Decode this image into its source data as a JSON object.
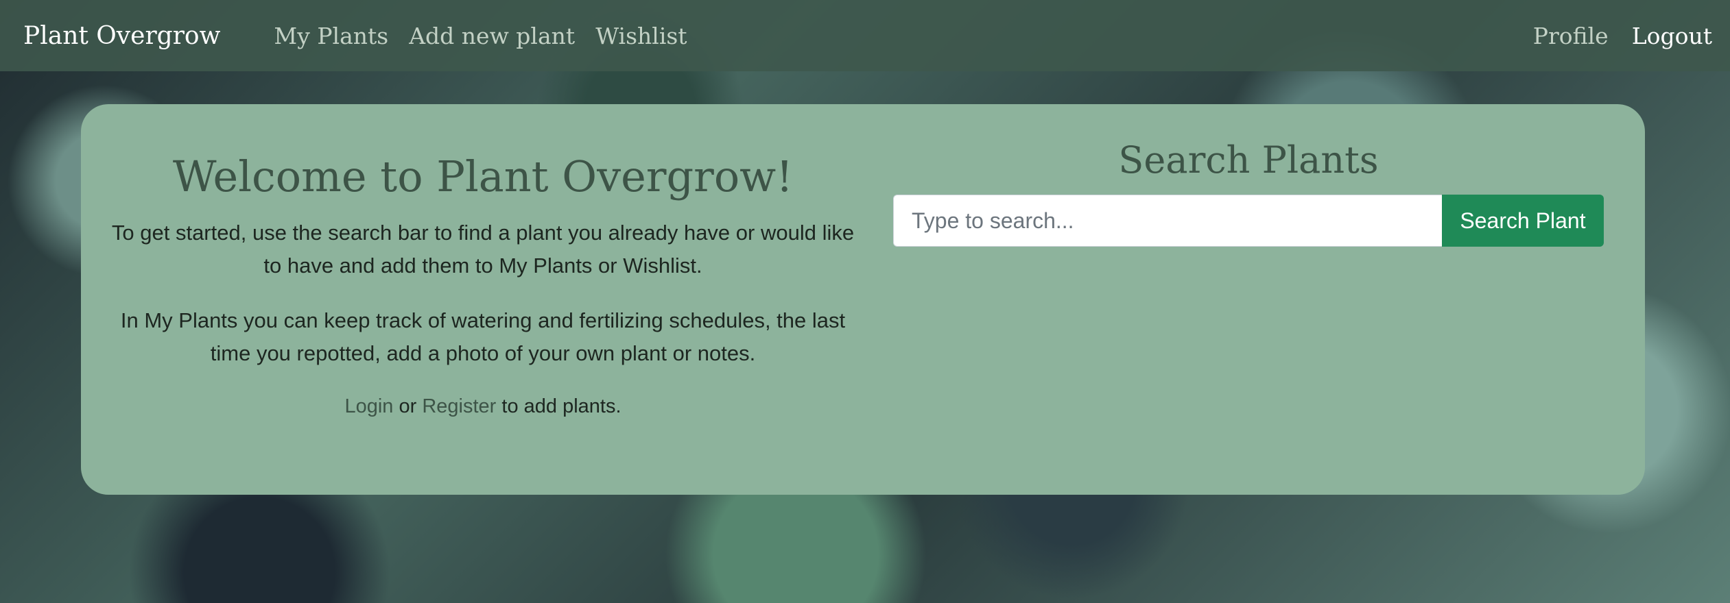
{
  "navbar": {
    "brand": "Plant Overgrow",
    "links": [
      "My Plants",
      "Add new plant",
      "Wishlist"
    ],
    "right_links": [
      "Profile",
      "Logout"
    ]
  },
  "welcome": {
    "title": "Welcome to Plant Overgrow!",
    "paragraph1": "To get started, use the search bar to find a plant you already have or would like to have and add them to My Plants or Wishlist.",
    "paragraph2": "In My Plants you can keep track of watering and fertilizing schedules, the last time you repotted, add a photo of your own plant or notes.",
    "login_label": "Login",
    "or_text": "or",
    "register_label": "Register",
    "suffix_text": "to add plants."
  },
  "search": {
    "title": "Search Plants",
    "placeholder": "Type to search...",
    "button_label": "Search Plant"
  },
  "colors": {
    "navbar": "#3e584c",
    "card": "#8db39c",
    "heading": "#3d5447",
    "button": "#1f8a57"
  }
}
